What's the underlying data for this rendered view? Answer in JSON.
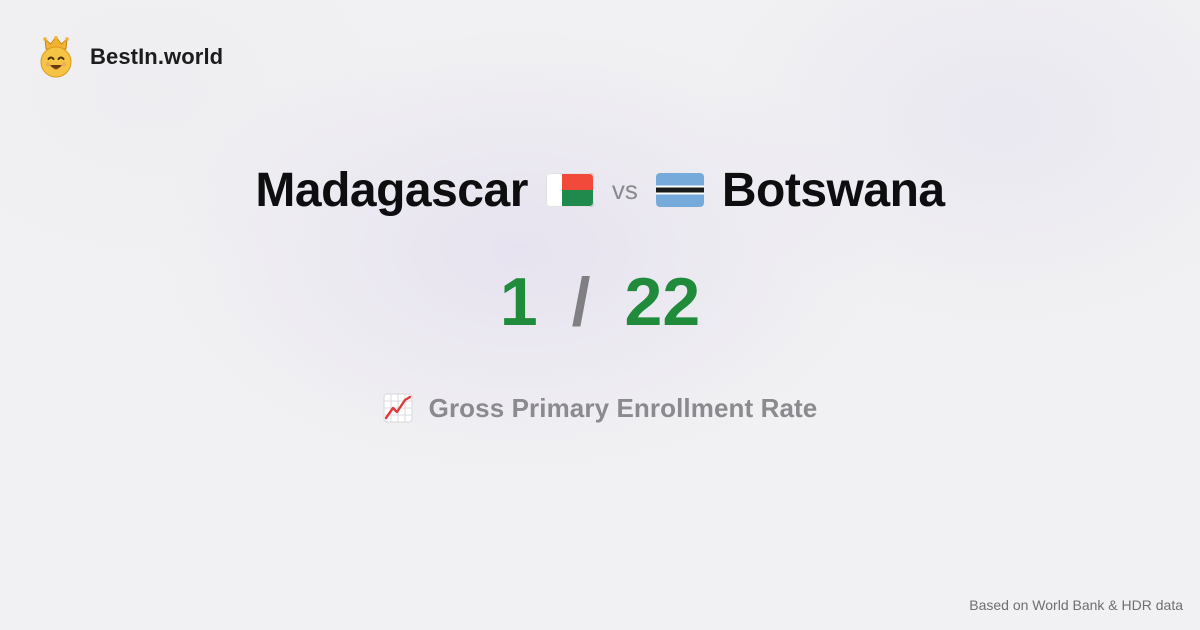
{
  "brand": {
    "name": "BestIn.world",
    "logo_icon": "crowned-smiley-icon"
  },
  "comparison": {
    "left_country": "Madagascar",
    "left_flag_icon": "madagascar-flag-icon",
    "vs_label": "vs",
    "right_country": "Botswana",
    "right_flag_icon": "botswana-flag-icon"
  },
  "scores": {
    "left_rank": "1",
    "separator": "/",
    "right_rank": "22",
    "rank_color": "#1f8b3b"
  },
  "metric": {
    "icon": "chart-increasing-icon",
    "label": "Gross Primary Enrollment Rate"
  },
  "footer": {
    "source_note": "Based on World Bank & HDR data"
  }
}
